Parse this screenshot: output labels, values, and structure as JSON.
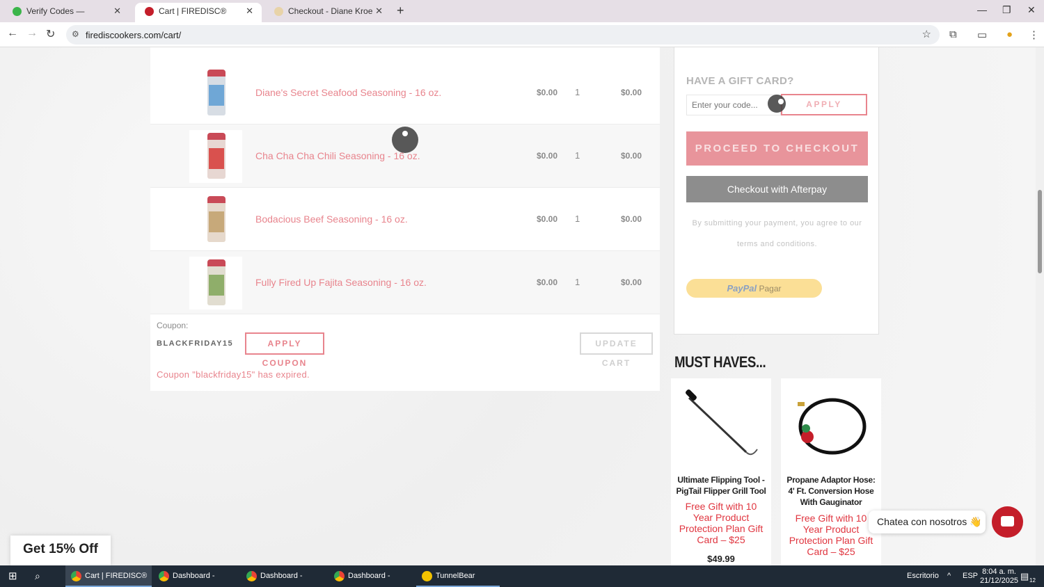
{
  "browser": {
    "tabs": [
      {
        "title": "Verify Codes — SimplyCodes",
        "active": false
      },
      {
        "title": "Cart | FIREDISC® Cookers",
        "active": true
      },
      {
        "title": "Checkout - Diane Kroe",
        "active": false
      }
    ],
    "url": "firediscookers.com/cart/"
  },
  "cart": {
    "items": [
      {
        "name": "Diane's Secret Seafood Seasoning - 16 oz.",
        "price": "$0.00",
        "qty": "1",
        "subtotal": "$0.00",
        "label_color": "#6fa7d6"
      },
      {
        "name": "Cha Cha Cha Chili Seasoning - 16 oz.",
        "price": "$0.00",
        "qty": "1",
        "subtotal": "$0.00",
        "label_color": "#d9514e"
      },
      {
        "name": "Bodacious Beef Seasoning - 16 oz.",
        "price": "$0.00",
        "qty": "1",
        "subtotal": "$0.00",
        "label_color": "#c7a97a"
      },
      {
        "name": "Fully Fired Up Fajita Seasoning - 16 oz.",
        "price": "$0.00",
        "qty": "1",
        "subtotal": "$0.00",
        "label_color": "#8fae6a"
      }
    ],
    "coupon_label": "Coupon:",
    "coupon_value": "BLACKFRIDAY15",
    "apply_coupon_label": "APPLY COUPON",
    "update_cart_label": "UPDATE CART",
    "coupon_message": "Coupon \"blackfriday15\" has expired."
  },
  "summary": {
    "gift_card_title": "HAVE A GIFT CARD?",
    "gift_card_placeholder": "Enter your code...",
    "gift_apply_label": "APPLY",
    "checkout_label": "PROCEED TO CHECKOUT",
    "afterpay_label": "Checkout with",
    "afterpay_alt": "Afterpay",
    "terms_line1": "By submitting your payment, you agree to our",
    "terms_line2": "terms and conditions.",
    "paypal_brand": "PayPal",
    "paypal_action": "Pagar"
  },
  "must_haves": {
    "title": "MUST HAVES...",
    "products": [
      {
        "title": "Ultimate Flipping Tool - PigTail Flipper Grill Tool",
        "gift": "Free Gift with 10 Year Product Protection Plan Gift Card – $25",
        "price": "$49.99"
      },
      {
        "title": "Propane Adaptor Hose: 4' Ft. Conversion Hose With Gauginator",
        "gift": "Free Gift with 10 Year Product Protection Plan Gift Card – $25",
        "price": ""
      }
    ]
  },
  "promo": {
    "label": "Get 15% Off"
  },
  "chat": {
    "label": "Chatea con nosotros 👋"
  },
  "taskbar": {
    "items": [
      "Cart | FIREDISC® C...",
      "Dashboard - Googl...",
      "Dashboard - Googl...",
      "Dashboard - Googl...",
      "TunnelBear"
    ],
    "desktop": "Escritorio",
    "lang": "ESP",
    "time": "8:04 a. m.",
    "date": "21/12/2025",
    "notifications": "12"
  },
  "colors": {
    "accent_pink": "#e8848d",
    "error_red": "#e0353f",
    "chat_red": "#c41e2a"
  }
}
